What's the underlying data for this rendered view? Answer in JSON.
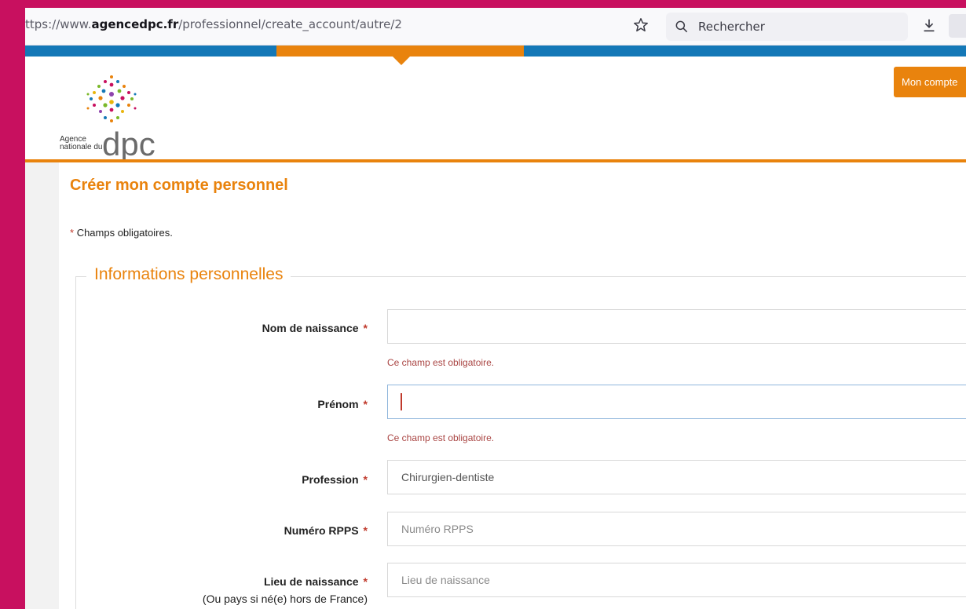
{
  "browser": {
    "url_prefix": "ttps://www.",
    "url_domain": "agencedpc.fr",
    "url_path": "/professionnel/create_account/autre/2",
    "search_label": "Rechercher"
  },
  "header": {
    "logo_text_line1": "Agence",
    "logo_text_line2": "nationale du",
    "logo_mark": "dpc",
    "account_button": "Mon compte"
  },
  "page": {
    "title": "Créer mon compte personnel",
    "required_star": "*",
    "required_note": "Champs obligatoires."
  },
  "section": {
    "legend": "Informations personnelles"
  },
  "fields": {
    "nom": {
      "label": "Nom de naissance",
      "star": "*",
      "value": "",
      "error": "Ce champ est obligatoire."
    },
    "prenom": {
      "label": "Prénom",
      "star": "*",
      "value": "",
      "error": "Ce champ est obligatoire."
    },
    "profession": {
      "label": "Profession",
      "star": "*",
      "value": "Chirurgien-dentiste"
    },
    "rpps": {
      "label": "Numéro RPPS",
      "star": "*",
      "placeholder": "Numéro RPPS"
    },
    "lieu": {
      "label": "Lieu de naissance",
      "star": "*",
      "placeholder": "Lieu de naissance",
      "sub_label": "(Ou pays si né(e) hors de France)"
    }
  },
  "colors": {
    "background": "#c8105f",
    "orange": "#e9830d",
    "blue": "#1478b7",
    "error": "#a94442"
  }
}
